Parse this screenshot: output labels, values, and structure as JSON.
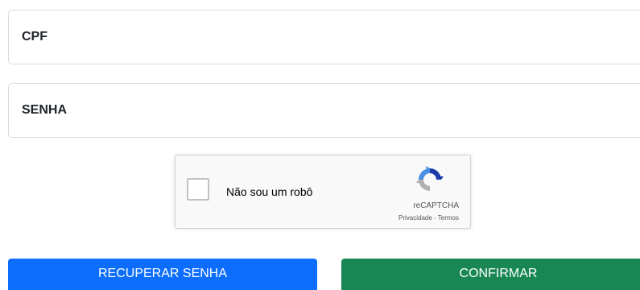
{
  "form": {
    "cpf_placeholder": "CPF",
    "cpf_value": "",
    "senha_placeholder": "SENHA",
    "senha_value": ""
  },
  "captcha": {
    "label": "Não sou um robô",
    "brand": "reCAPTCHA",
    "privacy_link": "Privacidade",
    "separator": " - ",
    "terms_link": "Termos",
    "checked": false,
    "logo_icon": "recaptcha-logo-icon"
  },
  "buttons": {
    "recover_label": "RECUPERAR SENHA",
    "confirm_label": "CONFIRMAR"
  },
  "colors": {
    "recover_button": "#0d6efd",
    "confirm_button": "#198754",
    "field_border": "#d9dbde",
    "captcha_background": "#f9f9f9"
  }
}
